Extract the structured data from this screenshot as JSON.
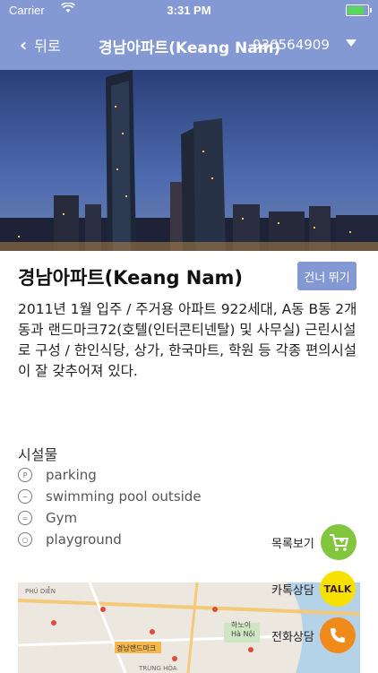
{
  "status_bar": {
    "carrier": "Carrier",
    "time": "3:31 PM"
  },
  "nav": {
    "back_label": "뒤로",
    "title": "경남아파트(Keang Nam)",
    "phone": "936564909"
  },
  "listing": {
    "name": "경남아파트(Keang Nam)",
    "skip_label": "건너 뛰기",
    "description": "2011년 1월 입주 / 주거용 아파트 922세대, A동 B동 2개동과 랜드마크72(호텔(인터콘티넨탈) 및 사무실) 근린시설로 구성 / 한인식당, 상가, 한국마트, 학원 등 각종 편의시설이 잘 갖추어져 있다."
  },
  "facilities": {
    "title": "시설물",
    "items": [
      {
        "label": "parking",
        "icon": "parking-icon"
      },
      {
        "label": "swimming pool outside",
        "icon": "pool-icon"
      },
      {
        "label": "Gym",
        "icon": "dumbbell-icon"
      },
      {
        "label": "playground",
        "icon": "playground-icon"
      }
    ]
  },
  "fabs": {
    "list_label": "목록보기",
    "talk_label": "카톡상담",
    "talk_badge": "TALK",
    "call_label": "전화상담"
  },
  "map": {
    "labels": [
      "PHÚ DIỄN",
      "경남랜드마크",
      "Hà Nội",
      "TRUNG HÒA",
      "하노이"
    ]
  },
  "colors": {
    "nav_bg": "#8499d4",
    "list_fab": "#82c53e",
    "talk_fab": "#f7e100",
    "call_fab": "#f08a1a"
  }
}
